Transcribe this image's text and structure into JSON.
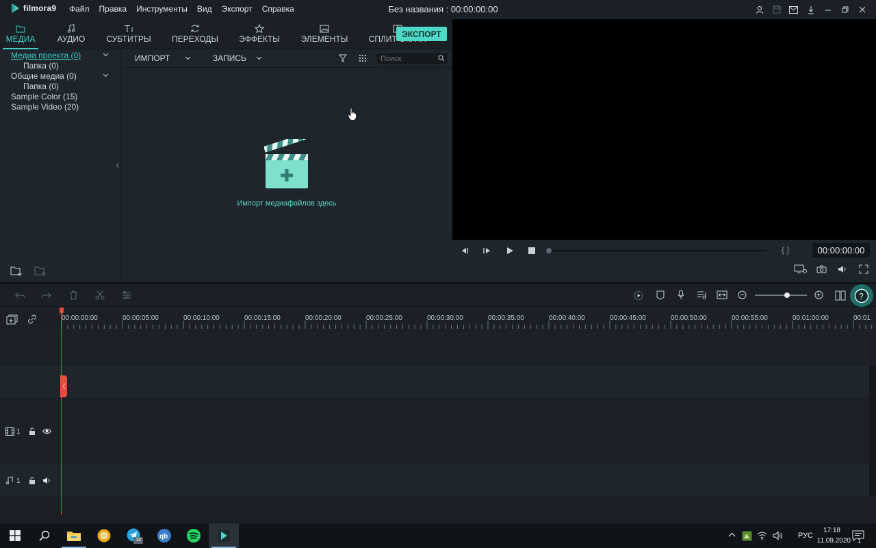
{
  "app": {
    "logo_text": "filmora9",
    "menu": [
      "Файл",
      "Правка",
      "Инструменты",
      "Вид",
      "Экспорт",
      "Справка"
    ],
    "doc_title": "Без названия : 00:00:00:00"
  },
  "tabs": [
    {
      "label": "МЕДИА",
      "icon": "folder-icon"
    },
    {
      "label": "АУДИО",
      "icon": "music-note-icon"
    },
    {
      "label": "СУБТИТРЫ",
      "icon": "text-icon"
    },
    {
      "label": "ПЕРЕХОДЫ",
      "icon": "transition-icon"
    },
    {
      "label": "ЭФФЕКТЫ",
      "icon": "effects-icon"
    },
    {
      "label": "ЭЛЕМЕНТЫ",
      "icon": "image-icon"
    },
    {
      "label": "СПЛИТ-ЭКРАН",
      "icon": "split-screen-icon"
    }
  ],
  "export_label": "ЭКСПОРТ",
  "sidebar": {
    "items": [
      {
        "label": "Медиа проекта (0)",
        "level": 0,
        "expandable": true,
        "selected": true
      },
      {
        "label": "Папка (0)",
        "level": 1
      },
      {
        "label": "Общие медиа (0)",
        "level": 0,
        "expandable": true
      },
      {
        "label": "Папка (0)",
        "level": 1
      },
      {
        "label": "Sample Color (15)",
        "level": 0
      },
      {
        "label": "Sample Video (20)",
        "level": 0
      }
    ]
  },
  "browser": {
    "import_label": "ИМПОРТ",
    "record_label": "ЗАПИСЬ",
    "search_placeholder": "Поиск",
    "import_hint": "Импорт медиафайлов здесь"
  },
  "preview": {
    "timecode": "00:00:00:00"
  },
  "timeline": {
    "ruler_labels": [
      "00:00:00:00",
      "00:00:05:00",
      "00:00:10:00",
      "00:00:15:00",
      "00:00:20:00",
      "00:00:25:00",
      "00:00:30:00",
      "00:00:35:00",
      "00:00:40:00",
      "00:00:45:00",
      "00:00:50:00",
      "00:00:55:00",
      "00:01:00:00",
      "00:01"
    ],
    "video_track_label": "1",
    "audio_track_label": "1",
    "zoom_level": 0.62
  },
  "taskbar": {
    "lang": "РУС",
    "time": "17:18",
    "date": "11.09.2020",
    "telegram_badge": "18",
    "notif_count": "1"
  },
  "colors": {
    "accent": "#3fd0c4",
    "playhead": "#e74c3c",
    "export_bg": "#4fd8c6"
  }
}
